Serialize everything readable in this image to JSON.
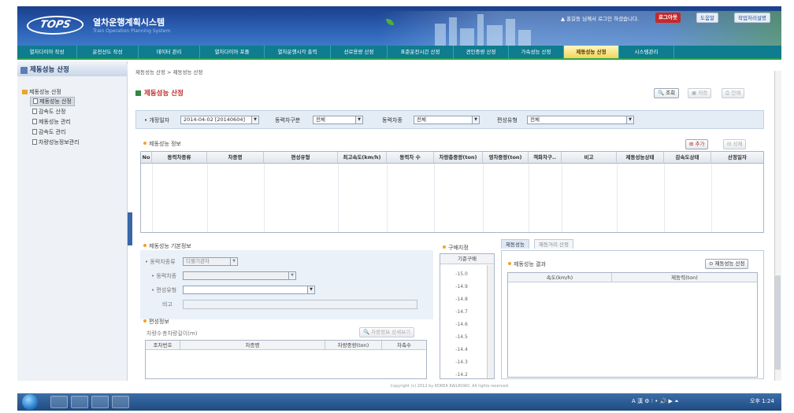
{
  "header": {
    "logo": "TOPS",
    "title": "열차운행계획시스템",
    "subtitle": "Train Operation Planning System",
    "welcome": "▲ 홍길동 님께서 로그인 하셨습니다.",
    "logout": "로그아웃",
    "help": "도움말",
    "manual": "작업처리설명"
  },
  "nav": {
    "items": [
      {
        "label": "열차다이아 작성"
      },
      {
        "label": "운전선도 작성"
      },
      {
        "label": "데이터 관리"
      },
      {
        "label": "열차다이아 포플"
      },
      {
        "label": "열차운행시각 출력"
      },
      {
        "label": "선로용량 산정"
      },
      {
        "label": "표준운전시간 산정"
      },
      {
        "label": "견인중량 산정"
      },
      {
        "label": "가속성능 산정"
      },
      {
        "label": "제동성능 산정"
      },
      {
        "label": "시스템관리"
      }
    ]
  },
  "sidebar": {
    "title": "제동성능 산정",
    "items": [
      {
        "label": "제동성능 산정"
      },
      {
        "label": "제동성능 산정"
      },
      {
        "label": "감속도 산정"
      },
      {
        "label": "제동성능 관리"
      },
      {
        "label": "감속도 관리"
      },
      {
        "label": "차량성능정보관리"
      }
    ]
  },
  "breadcrumb": "제동성능 산정 > 제동성능 산정",
  "page_title": "제동성능 산정",
  "top_buttons": {
    "search": "조회",
    "save": "저장",
    "print": "인쇄"
  },
  "filter": {
    "date_label": "• 개정일자",
    "date_value": "2014-04-02 [20140604]",
    "power_type_label": "동력차구분",
    "power_type_value": "전체",
    "vehicle_label": "동력차종",
    "vehicle_value": "전체",
    "formation_label": "편성유형",
    "formation_value": "전체"
  },
  "brake_info": {
    "title": "제동성능 정보",
    "add": "추가",
    "delete": "삭제",
    "columns": [
      "No",
      "동력차종류",
      "차종명",
      "편성유형",
      "최고속도(km/h)",
      "동력차 수",
      "차량총중량(ton)",
      "영차중량(ton)",
      "객화차구..",
      "비고",
      "제동성능상태",
      "감속도상태",
      "산정일자"
    ]
  },
  "basic_info": {
    "title": "제동성능 기본정보",
    "power_kind_label": "• 동력차종류",
    "power_kind_value": "디젤기관차",
    "vehicle_label": "• 동력차종",
    "formation_label": "• 편성유형",
    "remark_label": "비고"
  },
  "composition": {
    "title": "편성정보",
    "car_count_label": "차량수",
    "total_weight_label": "총차량길이(m)",
    "detail_button": "차량정보 상세보기",
    "columns": [
      "조차번호",
      "차종명",
      "차량중량(ton)",
      "차축수"
    ]
  },
  "gradient": {
    "title": "구배지정",
    "col_header": "기준구배",
    "values": [
      "-15.0",
      "-14.9",
      "-14.8",
      "-14.7",
      "-14.6",
      "-14.5",
      "-14.4",
      "-14.3",
      "-14.2"
    ]
  },
  "result": {
    "tab_active": "제동성능",
    "tab_inactive": "제동거리 산정",
    "title": "제동성능 결과",
    "calc_button": "제동성능 산정",
    "columns": [
      "속도(km/h)",
      "제동력(ton)"
    ]
  },
  "footer": "Copyright (c) 2012 by KOREA RAILROAD. All rights reserved.",
  "taskbar": {
    "tray": "A 漢 ⚙ ⁝ • 🔊 ▶ ⏶",
    "clock": "오후 1:24"
  }
}
